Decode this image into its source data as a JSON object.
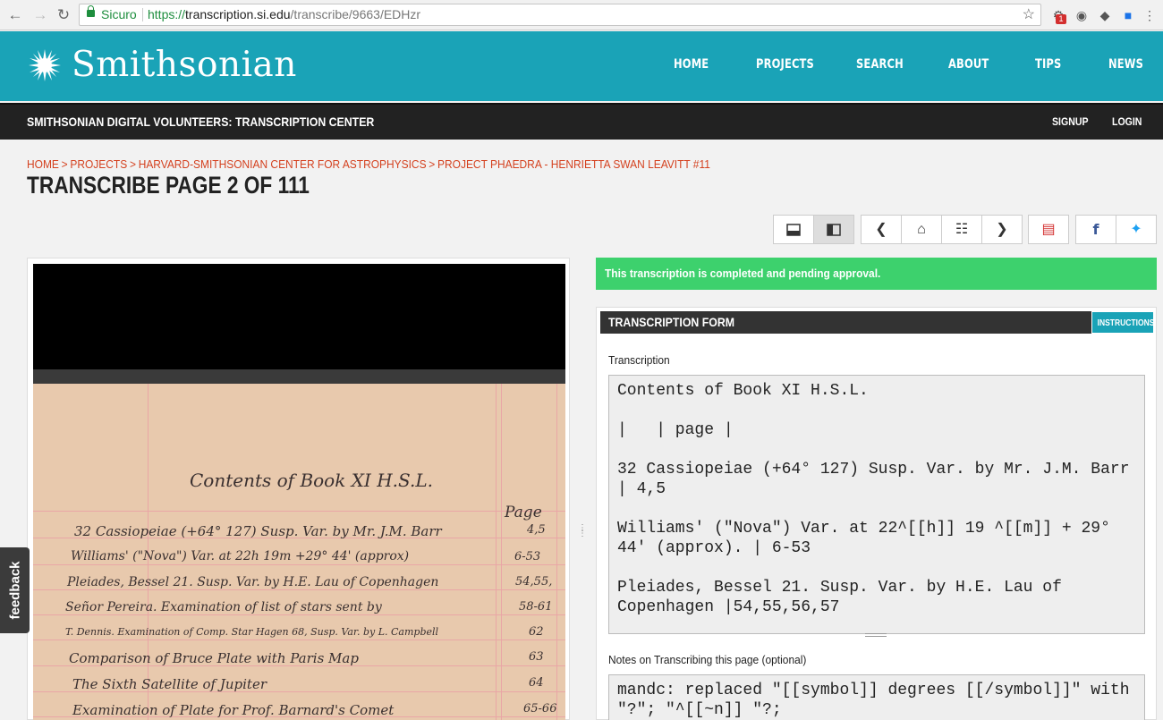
{
  "browser": {
    "secure_label": "Sicuro",
    "url_proto": "https://",
    "url_host": "transcription.si.edu",
    "url_path": "/transcribe/9663/EDHzr",
    "ext_badge": "1"
  },
  "header": {
    "logo": "Smithsonian",
    "nav": [
      "HOME",
      "PROJECTS",
      "SEARCH",
      "ABOUT",
      "TIPS",
      "NEWS"
    ]
  },
  "subbar": {
    "title": "SMITHSONIAN DIGITAL VOLUNTEERS: TRANSCRIPTION CENTER",
    "signup": "SIGNUP",
    "login": "LOGIN"
  },
  "breadcrumb": [
    "HOME",
    "PROJECTS",
    "HARVARD-SMITHSONIAN CENTER FOR ASTROPHYSICS",
    "PROJECT PHAEDRA - HENRIETTA SWAN LEAVITT #11"
  ],
  "page_title": "TRANSCRIBE PAGE 2 OF 111",
  "feedback": "feedback",
  "status": "This transcription is completed and pending approval.",
  "form": {
    "header": "TRANSCRIPTION FORM",
    "instructions": "INSTRUCTIONS",
    "transcription_label": "Transcription",
    "transcription_text": "Contents of Book XI H.S.L.\n\n|   | page |\n\n32 Cassiopeiae (+64° 127) Susp. Var. by Mr. J.M. Barr | 4,5\n\nWilliams' (\"Nova\") Var. at 22^[[h]] 19 ^[[m]] + 29° 44' (approx). | 6-53\n\nPleiades, Bessel 21. Susp. Var. by H.E. Lau of Copenhagen |54,55,56,57",
    "notes_label": "Notes on Transcribing this page (optional)",
    "notes_text": "mandc: replaced \"[[symbol]] degrees [[/symbol]]\" with \"?\"; \"^[[~n]] \"?;"
  },
  "manuscript": {
    "title": "Contents of Book XI H.S.L.",
    "page_header": "Page",
    "rows": [
      {
        "text": "32 Cassiopeiae (+64° 127) Susp. Var. by Mr. J.M. Barr",
        "page": "4,5"
      },
      {
        "text": "Williams' (\"Nova\") Var. at 22h 19m +29° 44' (approx)",
        "page": "6-53"
      },
      {
        "text": "Pleiades, Bessel 21. Susp. Var. by H.E. Lau of Copenhagen",
        "page": "54,55,"
      },
      {
        "text": "Señor Pereira. Examination of list of stars sent by",
        "page": "58-61"
      },
      {
        "text": "T. Dennis. Examination of Comp. Star Hagen 68, Susp. Var. by L. Campbell",
        "page": "62"
      },
      {
        "text": "Comparison of Bruce Plate with Paris Map",
        "page": "63"
      },
      {
        "text": "The Sixth Satellite of Jupiter",
        "page": "64"
      },
      {
        "text": "Examination of Plate for Prof. Barnard's Comet",
        "page": "65-66"
      }
    ]
  }
}
